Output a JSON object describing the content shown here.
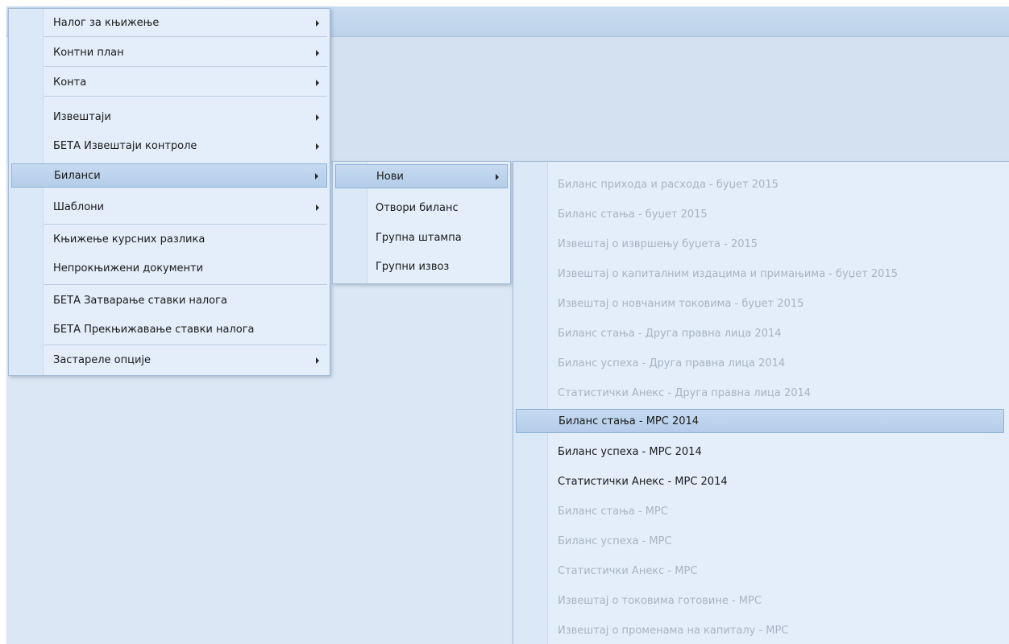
{
  "main_menu": {
    "items": [
      {
        "label": "Налог за књижење",
        "submenu": true
      },
      {
        "label": "Контни план",
        "submenu": true
      },
      {
        "label": "Конта",
        "submenu": true
      },
      {
        "label": "Извештаји",
        "submenu": true
      },
      {
        "label": "БЕТА Извештаји контроле",
        "submenu": true
      },
      {
        "label": "Биланси",
        "submenu": true,
        "active": true
      },
      {
        "label": "Шаблони",
        "submenu": true
      },
      {
        "label": "Књижење курсних разлика",
        "submenu": false
      },
      {
        "label": "Непрокњижени документи",
        "submenu": false
      },
      {
        "label": "БЕТА Затварање ставки налога",
        "submenu": false
      },
      {
        "label": "БЕТА Прекњижавање ставки налога",
        "submenu": false
      },
      {
        "label": "Застареле опције",
        "submenu": true
      }
    ]
  },
  "bilansi_menu": {
    "items": [
      {
        "label": "Нови",
        "submenu": true,
        "active": true
      },
      {
        "label": "Отвори биланс",
        "submenu": false
      },
      {
        "label": "Групна штампа",
        "submenu": false
      },
      {
        "label": "Групни извоз",
        "submenu": false
      }
    ]
  },
  "novi_menu": {
    "items": [
      {
        "label": "Биланс прихода и расхода - буџет 2015",
        "enabled": false
      },
      {
        "label": "Биланс стања - буџет 2015",
        "enabled": false
      },
      {
        "label": "Извештај о извршењу буџета - 2015",
        "enabled": false
      },
      {
        "label": "Извештај о капиталним издацима и примањима - буџет 2015",
        "enabled": false
      },
      {
        "label": "Извештај о новчаним токовима - буџет 2015",
        "enabled": false
      },
      {
        "label": "Биланс стања - Друга правна лица 2014",
        "enabled": false
      },
      {
        "label": "Биланс успеха - Друга правна лица 2014",
        "enabled": false
      },
      {
        "label": "Статистички Анекс - Друга правна лица 2014",
        "enabled": false
      },
      {
        "label": "Биланс стања - МРС 2014",
        "enabled": true,
        "active": true
      },
      {
        "label": "Биланс успеха - МРС 2014",
        "enabled": true
      },
      {
        "label": "Статистички Анекс - МРС 2014",
        "enabled": true
      },
      {
        "label": "Биланс стања - МРС",
        "enabled": false
      },
      {
        "label": "Биланс успеха - МРС",
        "enabled": false
      },
      {
        "label": "Статистички Анекс - МРС",
        "enabled": false
      },
      {
        "label": "Извештај о токовима готовине - МРС",
        "enabled": false
      },
      {
        "label": "Извештај о променама на капиталу - МРС",
        "enabled": false
      }
    ]
  }
}
